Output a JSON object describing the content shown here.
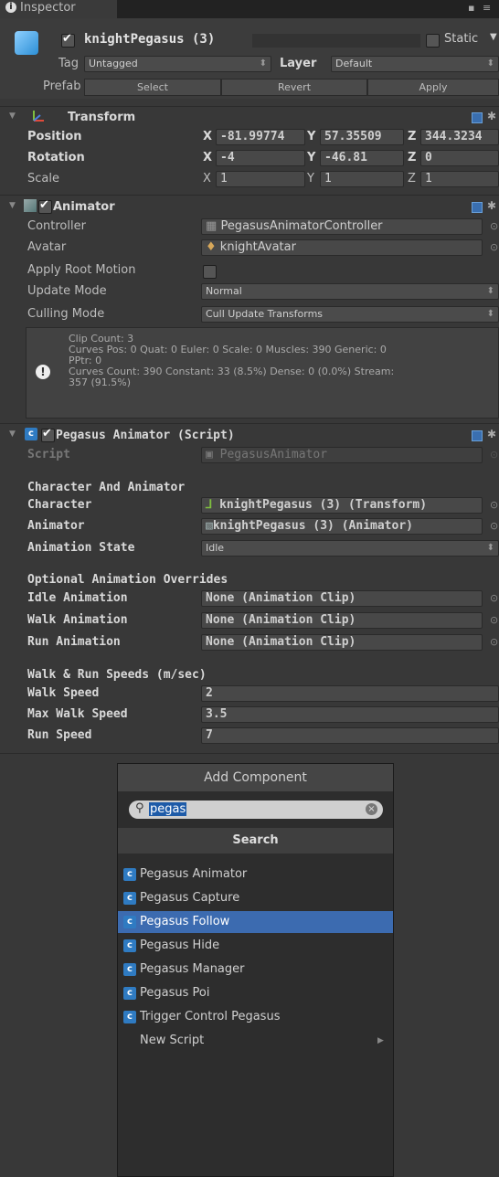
{
  "tab": {
    "title": "Inspector"
  },
  "object": {
    "name": "knightPegasus (3)",
    "static_label": "Static",
    "tag_label": "Tag",
    "tag_value": "Untagged",
    "layer_label": "Layer",
    "layer_value": "Default",
    "prefab_label": "Prefab",
    "prefab_buttons": [
      "Select",
      "Revert",
      "Apply"
    ]
  },
  "transform": {
    "title": "Transform",
    "position_label": "Position",
    "position": {
      "x": "-81.99774",
      "y": "57.35509",
      "z": "344.3234"
    },
    "rotation_label": "Rotation",
    "rotation": {
      "x": "-4",
      "y": "-46.81",
      "z": "0"
    },
    "scale_label": "Scale",
    "scale": {
      "x": "1",
      "y": "1",
      "z": "1"
    }
  },
  "animator": {
    "title": "Animator",
    "controller_label": "Controller",
    "controller_value": "PegasusAnimatorController",
    "avatar_label": "Avatar",
    "avatar_value": "knightAvatar",
    "root_motion_label": "Apply Root Motion",
    "update_mode_label": "Update Mode",
    "update_mode_value": "Normal",
    "culling_mode_label": "Culling Mode",
    "culling_mode_value": "Cull Update Transforms",
    "info_lines": [
      "Clip Count: 3",
      "Curves Pos: 0 Quat: 0 Euler: 0 Scale: 0 Muscles: 390 Generic: 0",
      "PPtr: 0",
      "Curves Count: 390 Constant: 33 (8.5%) Dense: 0 (0.0%) Stream:",
      "357 (91.5%)"
    ]
  },
  "script_comp": {
    "title": "Pegasus Animator (Script)",
    "script_label": "Script",
    "script_value": "PegasusAnimator",
    "section1": "Character And Animator",
    "character_label": "Character",
    "character_value": "knightPegasus (3) (Transform)",
    "animator_label": "Animator",
    "animator_value": "knightPegasus (3) (Animator)",
    "anim_state_label": "Animation State",
    "anim_state_value": "Idle",
    "section2": "Optional Animation Overrides",
    "idle_label": "Idle Animation",
    "idle_value": "None (Animation Clip)",
    "walk_label": "Walk Animation",
    "walk_value": "None (Animation Clip)",
    "run_label": "Run Animation",
    "run_value": "None (Animation Clip)",
    "section3": "Walk & Run Speeds (m/sec)",
    "walk_speed_label": "Walk Speed",
    "walk_speed_value": "2",
    "max_walk_label": "Max Walk Speed",
    "max_walk_value": "3.5",
    "run_speed_label": "Run Speed",
    "run_speed_value": "7"
  },
  "add_component": {
    "title": "Add Component",
    "search_text": "pegas",
    "search_header": "Search",
    "items": [
      "Pegasus Animator",
      "Pegasus Capture",
      "Pegasus Follow",
      "Pegasus Hide",
      "Pegasus Manager",
      "Pegasus Poi",
      "Trigger Control Pegasus"
    ],
    "new_script": "New Script"
  },
  "colors": {
    "background": "#383838",
    "highlight": "#3c6bb0",
    "accent": "#2f7bc2"
  }
}
